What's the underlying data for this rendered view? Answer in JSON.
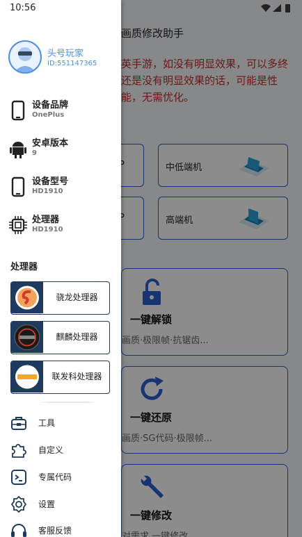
{
  "status_bar": {
    "time": "10:56"
  },
  "background_app": {
    "title": "画质修改助手",
    "notice": "英手游，如没有明显效果，可以多终还是没有明显效果的话，可能是性能，无需优化。",
    "tier_cards": [
      {
        "label": "P"
      },
      {
        "label": "中低端机"
      },
      {
        "label": "P"
      },
      {
        "label": "高端机"
      }
    ],
    "action_cards": [
      {
        "title": "一键解锁",
        "subtitle": "画质·极限帧·抗锯齿..."
      },
      {
        "title": "一键还原",
        "subtitle": "画质·SG代码·极限帧..."
      },
      {
        "title": "一键修改",
        "subtitle": "对需求 一键修改"
      }
    ]
  },
  "drawer": {
    "profile": {
      "name": "头号玩家",
      "id": "ID:551147365"
    },
    "device_info": [
      {
        "label": "设备品牌",
        "value": "OnePlus",
        "icon": "phone-icon"
      },
      {
        "label": "安卓版本",
        "value": "9",
        "icon": "android-icon"
      },
      {
        "label": "设备型号",
        "value": "HD1910",
        "icon": "phone-icon"
      },
      {
        "label": "处理器",
        "value": "HD1910",
        "icon": "cpu-icon"
      }
    ],
    "processor_section_title": "处理器",
    "processors": [
      {
        "name": "骁龙处理器",
        "icon": "snapdragon-logo"
      },
      {
        "name": "麒麟处理器",
        "icon": "kirin-logo"
      },
      {
        "name": "联发科处理器",
        "icon": "mediatek-logo"
      }
    ],
    "menu": [
      {
        "label": "工具",
        "icon": "toolbox-icon"
      },
      {
        "label": "自定义",
        "icon": "puzzle-icon"
      },
      {
        "label": "专属代码",
        "icon": "terminal-icon"
      },
      {
        "label": "设置",
        "icon": "gear-icon"
      },
      {
        "label": "客服反馈",
        "icon": "headset-icon"
      }
    ]
  },
  "colors": {
    "accent": "#4a90e2",
    "card_border": "#2f5fcf",
    "notice_red": "#c0302b",
    "chip_logo_bg": "#1e3a5f"
  }
}
